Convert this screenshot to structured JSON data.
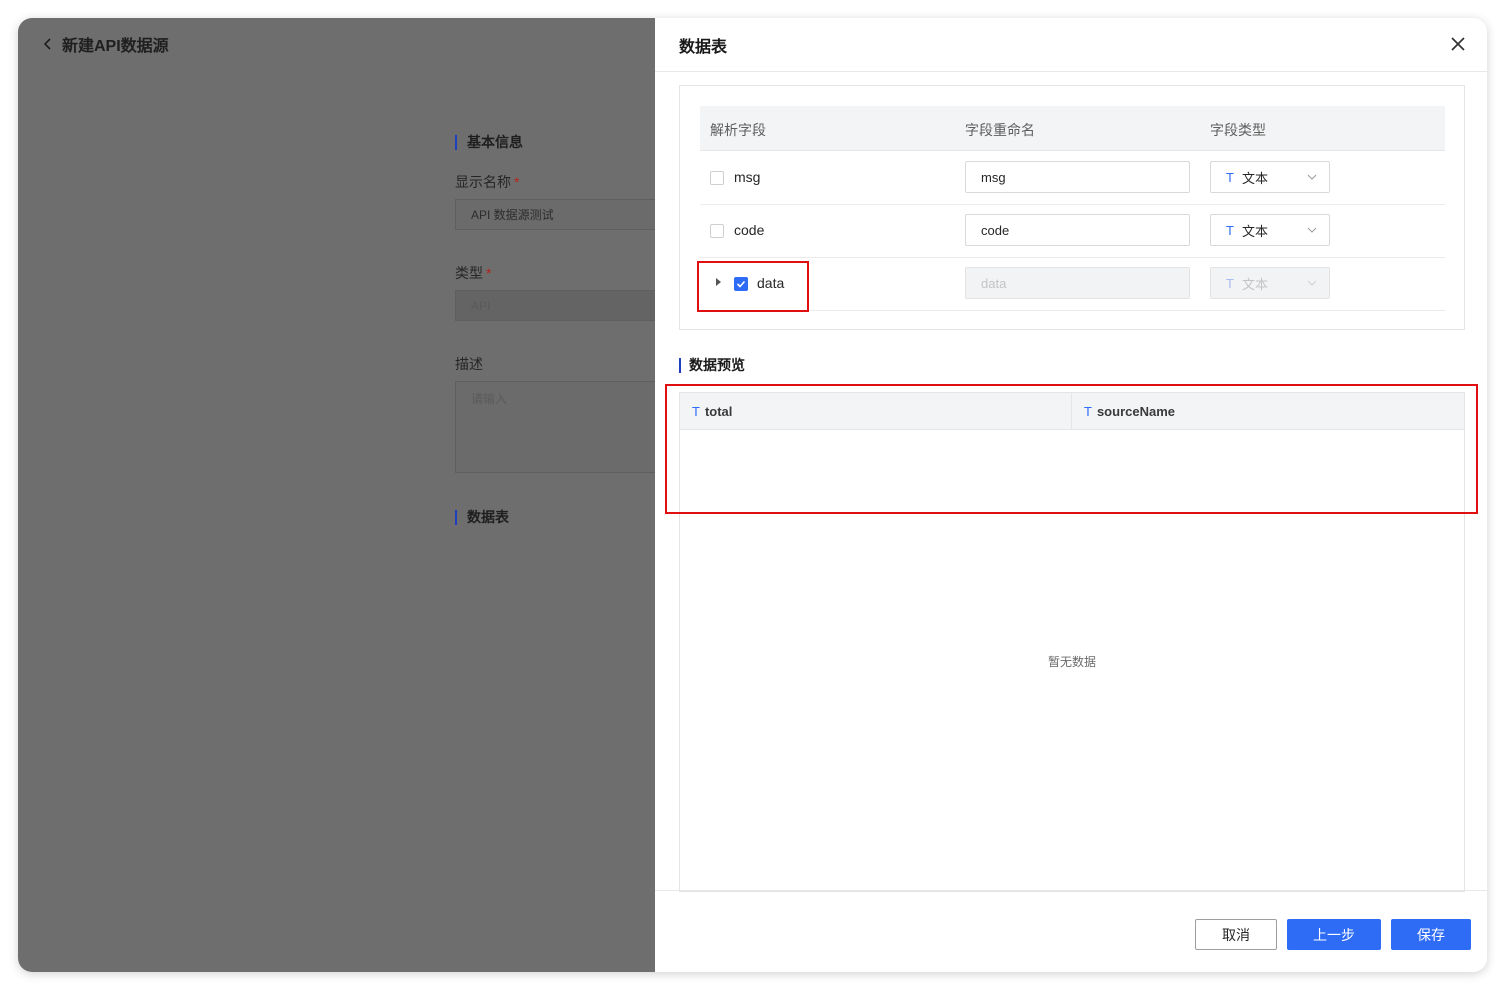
{
  "background_page": {
    "title": "新建API数据源",
    "basic_info_title": "基本信息",
    "display_name_label": "显示名称",
    "display_name_value": "API 数据源测试",
    "type_label": "类型",
    "type_value": "API",
    "description_label": "描述",
    "description_placeholder": "请输入",
    "data_table_title": "数据表",
    "required_mark": "*"
  },
  "drawer": {
    "title": "数据表",
    "fields_table": {
      "headers": [
        "解析字段",
        "字段重命名",
        "字段类型"
      ],
      "rows": [
        {
          "field": "msg",
          "checked": false,
          "rename": "msg",
          "type": "文本",
          "disabled": false
        },
        {
          "field": "code",
          "checked": false,
          "rename": "code",
          "type": "文本",
          "disabled": false
        },
        {
          "field": "data",
          "checked": true,
          "rename": "data",
          "type": "文本",
          "disabled": true
        }
      ],
      "type_icon": "T"
    },
    "preview": {
      "title": "数据预览",
      "columns": [
        {
          "icon": "T",
          "name": "total"
        },
        {
          "icon": "T",
          "name": "sourceName"
        }
      ],
      "empty_text": "暂无数据"
    },
    "buttons": {
      "cancel": "取消",
      "prev": "上一步",
      "save": "保存"
    }
  },
  "colors": {
    "accent": "#2f6cf6",
    "highlight": "#e01010",
    "overlay": "#6e6e6e"
  }
}
